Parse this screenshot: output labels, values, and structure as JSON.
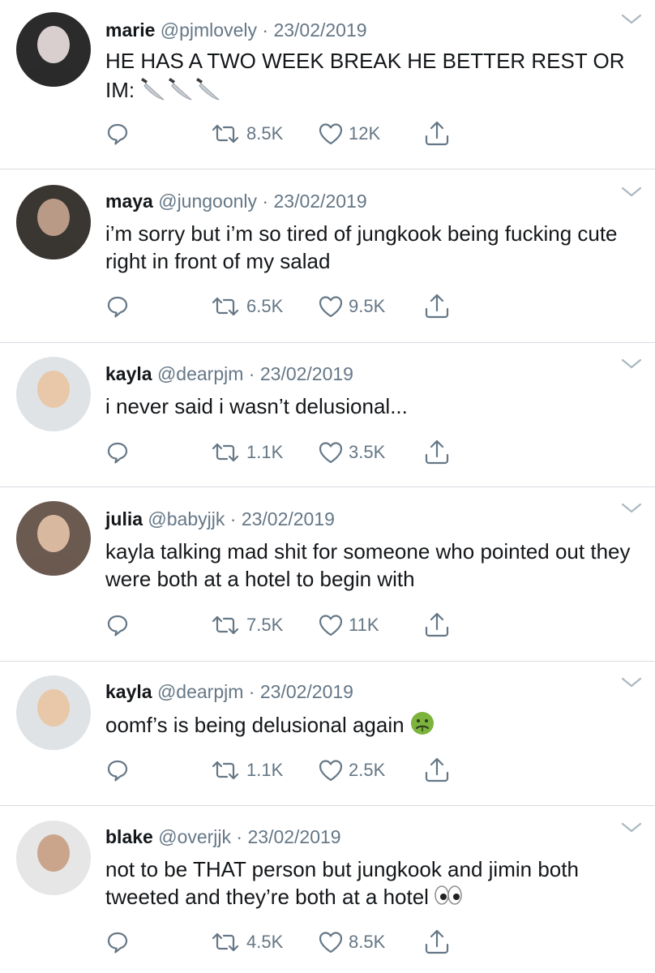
{
  "tweets": [
    {
      "name": "marie",
      "handle": "@pjmlovely",
      "date": "23/02/2019",
      "text": "HE HAS A TWO WEEK BREAK HE BETTER REST OR IM:",
      "emoji": "kitchen-knife-emoji-x3",
      "retweets": "8.5K",
      "likes": "12K",
      "avatar_colors": [
        "#2b2b2b",
        "#d9cfcf"
      ]
    },
    {
      "name": "maya",
      "handle": "@jungoonly",
      "date": "23/02/2019",
      "text": "i’m sorry but i’m so tired of jungkook being fucking cute right in front of my salad",
      "retweets": "6.5K",
      "likes": "9.5K",
      "avatar_colors": [
        "#3a3632",
        "#b89a86"
      ]
    },
    {
      "name": "kayla",
      "handle": "@dearpjm",
      "date": "23/02/2019",
      "text": "i never said i wasn’t delusional...",
      "retweets": "1.1K",
      "likes": "3.5K",
      "avatar_colors": [
        "#dfe3e6",
        "#e8c8a8"
      ]
    },
    {
      "name": "julia",
      "handle": "@babyjjk",
      "date": "23/02/2019",
      "text": "kayla talking mad shit for someone who pointed out they were both at a hotel to begin with",
      "retweets": "7.5K",
      "likes": "11K",
      "avatar_colors": [
        "#6b5a50",
        "#d9b8a0"
      ]
    },
    {
      "name": "kayla",
      "handle": "@dearpjm",
      "date": "23/02/2019",
      "text": "oomf’s is being delusional again",
      "emoji": "nauseated-face-emoji",
      "retweets": "1.1K",
      "likes": "2.5K",
      "avatar_colors": [
        "#dfe3e6",
        "#e8c8a8"
      ]
    },
    {
      "name": "blake",
      "handle": "@overjjk",
      "date": "23/02/2019",
      "text": "not to be THAT person but jungkook and jimin both tweeted and they’re both at a hotel",
      "emoji": "eyes-emoji",
      "retweets": "4.5K",
      "likes": "8.5K",
      "avatar_colors": [
        "#e6e6e6",
        "#caa58c"
      ]
    }
  ],
  "colors": {
    "name": "#14171a",
    "secondary": "#657786",
    "divider": "#d6dbe0",
    "caret": "#aab8c2"
  },
  "icons": [
    "reply-icon",
    "retweet-icon",
    "like-icon",
    "share-icon",
    "caret-down-icon"
  ]
}
